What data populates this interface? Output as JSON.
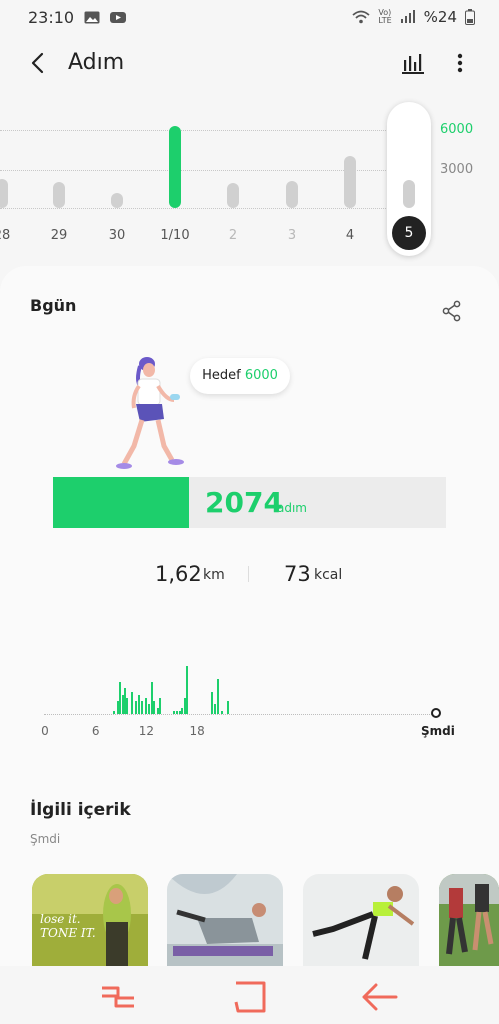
{
  "status_bar": {
    "time": "23:10",
    "network_label": "LTE",
    "volte_label": "Vo)",
    "battery": "%24",
    "icons": [
      "image-icon",
      "youtube-icon",
      "wifi-icon",
      "signal-icon",
      "battery-icon"
    ]
  },
  "header": {
    "title": "Adım",
    "back_icon": "chevron-left-icon",
    "chart_icon": "bar-chart-icon",
    "more_icon": "more-vertical-icon"
  },
  "week_chart": {
    "grid_labels": [
      "6000",
      "3000"
    ],
    "days": [
      {
        "label": "28",
        "value": 2100,
        "dim": false
      },
      {
        "label": "29",
        "value": 1900,
        "dim": false
      },
      {
        "label": "30",
        "value": 1100,
        "dim": false
      },
      {
        "label": "1/10",
        "value": 6000,
        "dim": false,
        "goal_met": true
      },
      {
        "label": "2",
        "value": 1800,
        "dim": true
      },
      {
        "label": "3",
        "value": 2000,
        "dim": true
      },
      {
        "label": "4",
        "value": 3800,
        "dim": false
      },
      {
        "label": "5",
        "value": 2074,
        "dim": false,
        "selected": true
      }
    ]
  },
  "today": {
    "title": "Bgün",
    "share_icon": "share-icon",
    "goal_label": "Hedef",
    "goal_value": "6000",
    "goal": 6000,
    "steps": "2074",
    "steps_count": 2074,
    "steps_unit": "adım",
    "distance": "1,62",
    "distance_unit": "km",
    "calories": "73",
    "calories_unit": "kcal"
  },
  "day_chart": {
    "type": "bar",
    "x_labels": [
      "0",
      "6",
      "12",
      "18"
    ],
    "now_label": "Şmdi",
    "bars": [
      {
        "hour": 8.1,
        "value": 1
      },
      {
        "hour": 8.5,
        "value": 4
      },
      {
        "hour": 8.8,
        "value": 10
      },
      {
        "hour": 9.1,
        "value": 6
      },
      {
        "hour": 9.3,
        "value": 8
      },
      {
        "hour": 9.6,
        "value": 5
      },
      {
        "hour": 10.2,
        "value": 7
      },
      {
        "hour": 10.6,
        "value": 4
      },
      {
        "hour": 11.0,
        "value": 6
      },
      {
        "hour": 11.4,
        "value": 4
      },
      {
        "hour": 11.8,
        "value": 5
      },
      {
        "hour": 12.2,
        "value": 3
      },
      {
        "hour": 12.5,
        "value": 10
      },
      {
        "hour": 12.8,
        "value": 4
      },
      {
        "hour": 13.2,
        "value": 2
      },
      {
        "hour": 13.5,
        "value": 5
      },
      {
        "hour": 15.2,
        "value": 1
      },
      {
        "hour": 15.5,
        "value": 1
      },
      {
        "hour": 15.8,
        "value": 1
      },
      {
        "hour": 16.1,
        "value": 2
      },
      {
        "hour": 16.4,
        "value": 5
      },
      {
        "hour": 16.7,
        "value": 15
      },
      {
        "hour": 19.7,
        "value": 7
      },
      {
        "hour": 20.0,
        "value": 3
      },
      {
        "hour": 20.4,
        "value": 11
      },
      {
        "hour": 20.8,
        "value": 1
      },
      {
        "hour": 21.5,
        "value": 4
      }
    ]
  },
  "related": {
    "title": "İlgili içerik",
    "subtitle": "Şmdi",
    "thumbs": [
      {
        "name": "thumb-lose-it",
        "overlay": "lose it. TONE IT."
      },
      {
        "name": "thumb-yoga-pose",
        "overlay": ""
      },
      {
        "name": "thumb-balance-pose",
        "overlay": ""
      },
      {
        "name": "thumb-runners",
        "overlay": ""
      }
    ]
  },
  "nav_bar": {
    "buttons": [
      "recents-icon",
      "home-icon",
      "back-arrow-icon"
    ],
    "color": "#f06a5b"
  },
  "colors": {
    "accent": "#1dcf6c",
    "bar_gray": "#d0d0d0"
  }
}
